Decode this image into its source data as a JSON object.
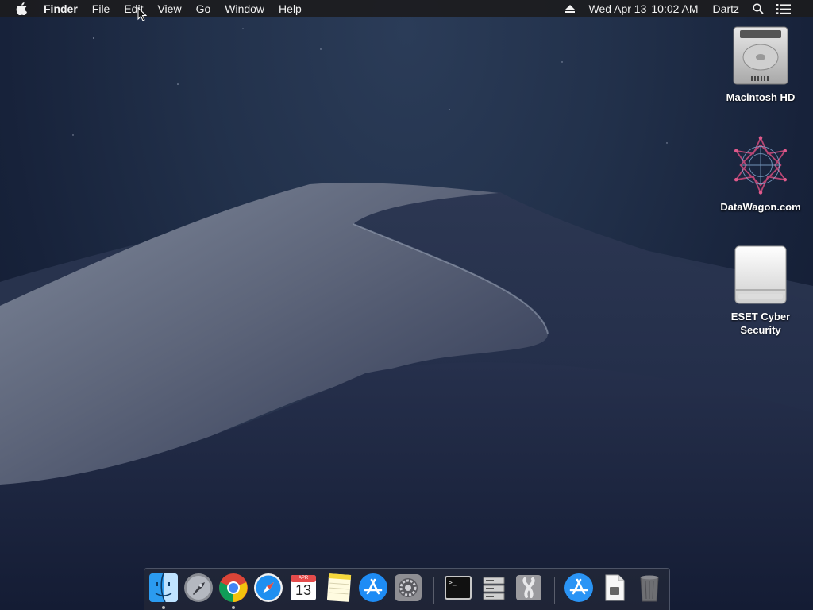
{
  "menubar": {
    "app_name": "Finder",
    "menus": [
      "File",
      "Edit",
      "View",
      "Go",
      "Window",
      "Help"
    ],
    "status": {
      "date": "Wed Apr 13",
      "time": "10:02 AM",
      "user": "Dartz",
      "icons": [
        "eject-icon",
        "spotlight-search-icon",
        "notification-center-icon"
      ]
    }
  },
  "desktop": {
    "icons": [
      {
        "label": "Macintosh HD",
        "icon": "hard-drive-icon"
      },
      {
        "label": "DataWagon.com",
        "icon": "datawagon-logo-icon"
      },
      {
        "label": "ESET Cyber Security",
        "icon": "external-drive-icon"
      }
    ]
  },
  "dock": {
    "items": [
      {
        "name": "finder",
        "icon": "finder-icon",
        "running": true
      },
      {
        "name": "launchpad",
        "icon": "launchpad-icon",
        "running": false
      },
      {
        "name": "chrome",
        "icon": "chrome-icon",
        "running": true
      },
      {
        "name": "safari",
        "icon": "safari-icon",
        "running": false
      },
      {
        "name": "calendar",
        "icon": "calendar-icon",
        "running": false,
        "month": "APR",
        "day": "13"
      },
      {
        "name": "notes",
        "icon": "notes-icon",
        "running": false
      },
      {
        "name": "app-store",
        "icon": "app-store-icon",
        "running": false
      },
      {
        "name": "system-preferences",
        "icon": "system-preferences-icon",
        "running": false
      },
      {
        "name": "terminal",
        "icon": "terminal-icon",
        "running": false,
        "prompt": ">_"
      },
      {
        "name": "utility",
        "icon": "server-stack-icon",
        "running": false
      },
      {
        "name": "installer",
        "icon": "installer-ribbon-icon",
        "running": false
      },
      {
        "name": "app-store-download",
        "icon": "app-store-download-icon",
        "running": false
      },
      {
        "name": "document",
        "icon": "document-icon",
        "running": false
      },
      {
        "name": "trash",
        "icon": "trash-icon",
        "running": false
      }
    ]
  },
  "colors": {
    "menubar_bg": "#1c1c1e",
    "dock_blue": "#1f8ff0",
    "desktop_label": "#ffffff"
  }
}
